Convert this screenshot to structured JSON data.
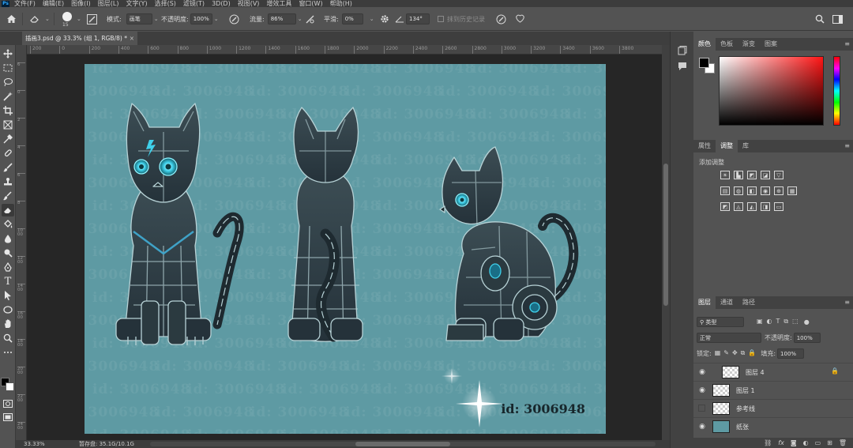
{
  "app": {
    "logo": "Ps"
  },
  "menu": [
    "文件(F)",
    "编辑(E)",
    "图像(I)",
    "图层(L)",
    "文字(Y)",
    "选择(S)",
    "滤镜(T)",
    "3D(D)",
    "视图(V)",
    "增效工具",
    "窗口(W)",
    "帮助(H)"
  ],
  "options": {
    "brush_size": "15",
    "mode_label": "模式:",
    "mode_value": "画笔",
    "opacity_label": "不透明度:",
    "opacity_value": "100%",
    "flow_label": "流量:",
    "flow_value": "86%",
    "smooth_label": "平滑:",
    "smooth_value": "0%",
    "angle_value": "134°",
    "erase_history_label": "抹到历史记录"
  },
  "document": {
    "tab_title": "插画3.psd @ 33.3% (组 1, RGB/8) *",
    "close_symbol": "×",
    "watermark_text": "id: 3006948",
    "id_text": "id:  3006948"
  },
  "rulers": {
    "top": [
      "200",
      "0",
      "200",
      "400",
      "600",
      "800",
      "1000",
      "1200",
      "1400",
      "1600",
      "1800",
      "2000",
      "2200",
      "2400",
      "2600",
      "2800",
      "3000",
      "3200",
      "3400",
      "3600",
      "3800"
    ],
    "left": [
      "6",
      "0",
      "2",
      "4",
      "6",
      "8",
      "1000",
      "1200",
      "1400",
      "1600",
      "1800",
      "2000",
      "2200",
      "2400"
    ]
  },
  "status": {
    "zoom": "33.33%",
    "doc": "暂存盘: 35.1G/10.1G"
  },
  "color_panel": {
    "tabs": [
      "颜色",
      "色板",
      "渐变",
      "图案"
    ],
    "active": 0,
    "fg_color": "#000000",
    "bg_color": "#ffffff"
  },
  "adjust_panel": {
    "tabs": [
      "属性",
      "调整",
      "库"
    ],
    "active": 1,
    "title": "添加调整",
    "icons": [
      "brightness-icon",
      "levels-icon",
      "curves-icon",
      "exposure-icon",
      "vibrance-icon",
      "hue-sat-icon",
      "color-balance-icon",
      "bw-icon",
      "photo-filter-icon",
      "channel-mixer-icon",
      "color-lookup-icon",
      "invert-icon",
      "posterize-icon",
      "threshold-icon",
      "selective-color-icon",
      "gradient-map-icon"
    ]
  },
  "layers_panel": {
    "tabs": [
      "图层",
      "通道",
      "路径"
    ],
    "active": 0,
    "filter_label": "类型",
    "blend_mode": "正常",
    "opacity_label": "不透明度:",
    "opacity_value": "100%",
    "lock_label": "锁定:",
    "fill_label": "填充:",
    "fill_value": "100%",
    "layers": [
      {
        "name": "图层 4",
        "visible": true,
        "locked": true,
        "type": "transparent"
      },
      {
        "name": "图层 1",
        "visible": true,
        "locked": false,
        "type": "transparent"
      },
      {
        "name": "参考线",
        "visible": false,
        "locked": false,
        "type": "transparent"
      },
      {
        "name": "纸张",
        "visible": true,
        "locked": false,
        "type": "fill",
        "fill_color": "#5e9aa3"
      }
    ]
  },
  "colors": {
    "canvas_bg": "#5e9aa3",
    "robot_dark": "#2b3a40",
    "robot_accent": "#3fd0ea"
  }
}
